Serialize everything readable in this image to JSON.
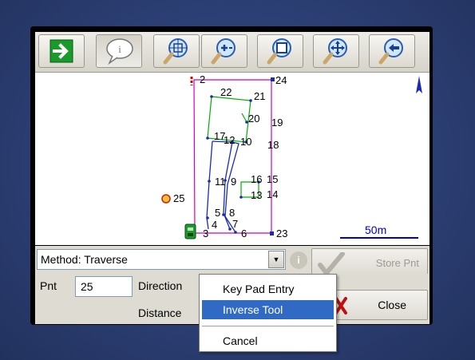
{
  "toolbar": {
    "buttons": [
      {
        "icon": "arrow-right-icon"
      },
      {
        "icon": "info-bubble-icon"
      },
      {
        "icon": "zoom-extents-icon"
      },
      {
        "icon": "zoom-in-icon"
      },
      {
        "icon": "zoom-window-icon"
      },
      {
        "icon": "pan-icon"
      },
      {
        "icon": "zoom-previous-icon"
      }
    ]
  },
  "map": {
    "scale_label": "50m",
    "north_label": "A",
    "points": [
      {
        "label": "2"
      },
      {
        "label": "24"
      },
      {
        "label": "22"
      },
      {
        "label": "21"
      },
      {
        "label": "20"
      },
      {
        "label": "19"
      },
      {
        "label": "17"
      },
      {
        "label": "12"
      },
      {
        "label": "10"
      },
      {
        "label": "18"
      },
      {
        "label": "16"
      },
      {
        "label": "15"
      },
      {
        "label": "11"
      },
      {
        "label": "9"
      },
      {
        "label": "13"
      },
      {
        "label": "14"
      },
      {
        "label": "25"
      },
      {
        "label": "5"
      },
      {
        "label": "8"
      },
      {
        "label": "4"
      },
      {
        "label": "7"
      },
      {
        "label": "3"
      },
      {
        "label": "6"
      },
      {
        "label": "23"
      }
    ],
    "colors": {
      "boundary": "#cc00cc",
      "green_lots": "#00b000",
      "blue_lines": "#1a2bb0",
      "scale_bar": "#0000cc",
      "point_25": "#f2a000"
    }
  },
  "method": {
    "value": "Method: Traverse",
    "store_label": "Store Pnt"
  },
  "form": {
    "pnt_label": "Pnt",
    "pnt_value": "25",
    "direction_label": "Direction",
    "distance_label": "Distance",
    "close_label": "Close"
  },
  "popup_menu": {
    "items": [
      "Key Pad Entry",
      "Inverse Tool",
      "Cancel"
    ],
    "selected": "Inverse Tool"
  }
}
